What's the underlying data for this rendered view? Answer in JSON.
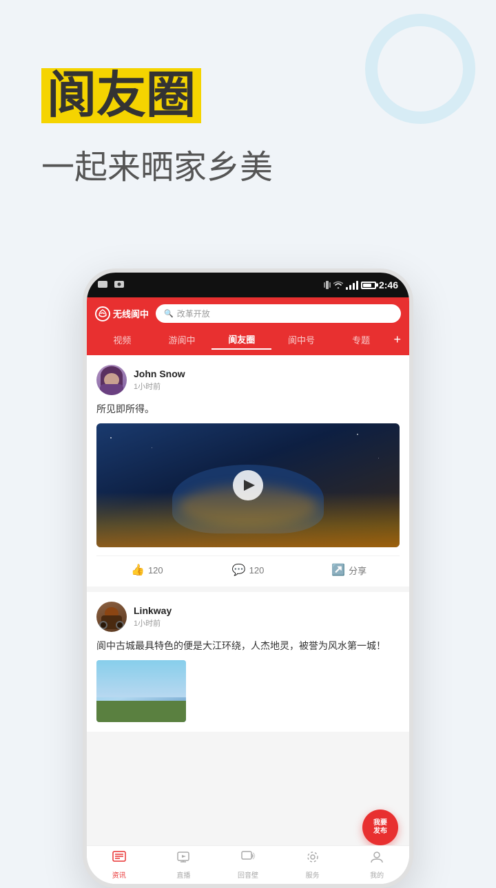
{
  "app": {
    "name": "无线阆中",
    "logo_text": "无线阆中"
  },
  "promo": {
    "title": "阆友圈",
    "subtitle": "一起来晒家乡美"
  },
  "status_bar": {
    "time": "2:46"
  },
  "search": {
    "placeholder": "改革开放"
  },
  "nav_tabs": [
    {
      "label": "视频",
      "active": false
    },
    {
      "label": "游阆中",
      "active": false
    },
    {
      "label": "阆友圈",
      "active": true
    },
    {
      "label": "阆中号",
      "active": false
    },
    {
      "label": "专题",
      "active": false
    }
  ],
  "posts": [
    {
      "username": "John Snow",
      "time": "1小时前",
      "text": "所见即所得。",
      "likes": "120",
      "comments": "120",
      "share": "分享"
    },
    {
      "username": "Linkway",
      "time": "1小时前",
      "text": "阆中古城最具特色的便是大江环绕，人杰地灵，被誉为风水第一城！"
    }
  ],
  "fab": {
    "label": "我要\n发布"
  },
  "bottom_nav": [
    {
      "label": "资讯",
      "active": true,
      "icon": "📰"
    },
    {
      "label": "直播",
      "active": false,
      "icon": "📺"
    },
    {
      "label": "回音壁",
      "active": false,
      "icon": "💬"
    },
    {
      "label": "服务",
      "active": false,
      "icon": "⚙️"
    },
    {
      "label": "我的",
      "active": false,
      "icon": "👤"
    }
  ]
}
